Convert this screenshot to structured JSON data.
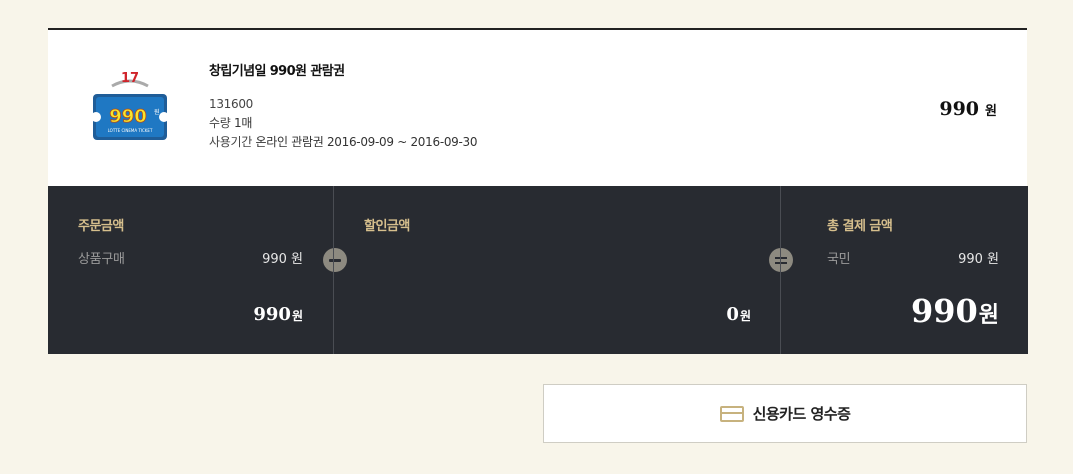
{
  "product": {
    "name": "창립기념일 990원 관람권",
    "code": "131600",
    "qty_label": "수량",
    "qty_value": "1매",
    "period_label": "사용기간",
    "period_value": "온라인 관람권 2016-09-09 ~ 2016-09-30",
    "price": "990",
    "price_unit": "원",
    "thumb": {
      "badge_number": "17",
      "ticket_text": "990",
      "ticket_suffix": "원",
      "ticket_caption": "LOTTE CINEMA TICKET",
      "colors": {
        "ticket": "#1f78c3",
        "ticket_text": "#f7e62c",
        "badge": "#d0242b"
      }
    }
  },
  "summary": {
    "order": {
      "title": "주문금액",
      "row_label": "상품구매",
      "row_value": "990 원",
      "total": "990",
      "total_unit": "원"
    },
    "discount": {
      "title": "할인금액",
      "total": "0",
      "total_unit": "원"
    },
    "payment": {
      "title": "총 결제 금액",
      "row_label": "국민",
      "row_value": "990 원",
      "total": "990",
      "total_unit": "원"
    },
    "colors": {
      "panel": "#282b31",
      "title": "#d6bf8d"
    }
  },
  "receipt_button": {
    "label": "신용카드 영수증",
    "icon": "credit-card-icon"
  }
}
